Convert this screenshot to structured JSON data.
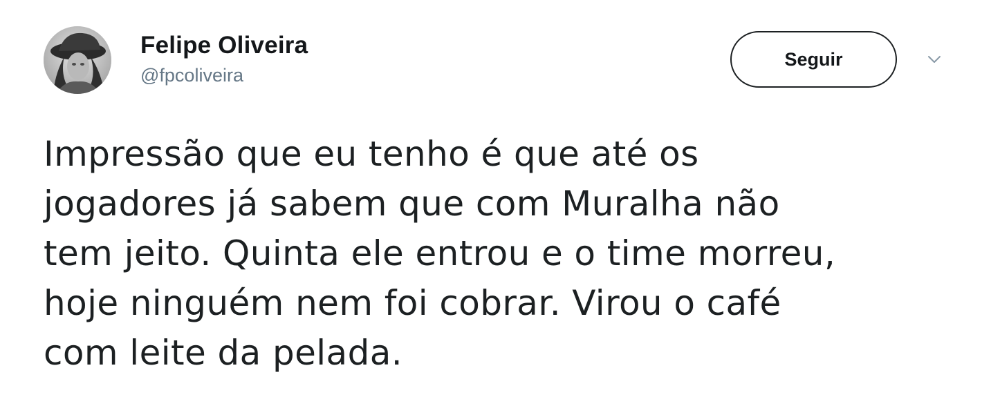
{
  "tweet": {
    "author": {
      "display_name": "Felipe Oliveira",
      "handle": "@fpcoliveira"
    },
    "follow_button_label": "Seguir",
    "text": "Impressão que eu tenho é que até os\njogadores já sabem que com Muralha não\ntem jeito. Quinta ele entrou e o time morreu,\nhoje ninguém nem foi cobrar. Virou o café\ncom leite da pelada.",
    "icons": {
      "avatar": "user-avatar-photo",
      "menu": "chevron-down-icon"
    }
  }
}
